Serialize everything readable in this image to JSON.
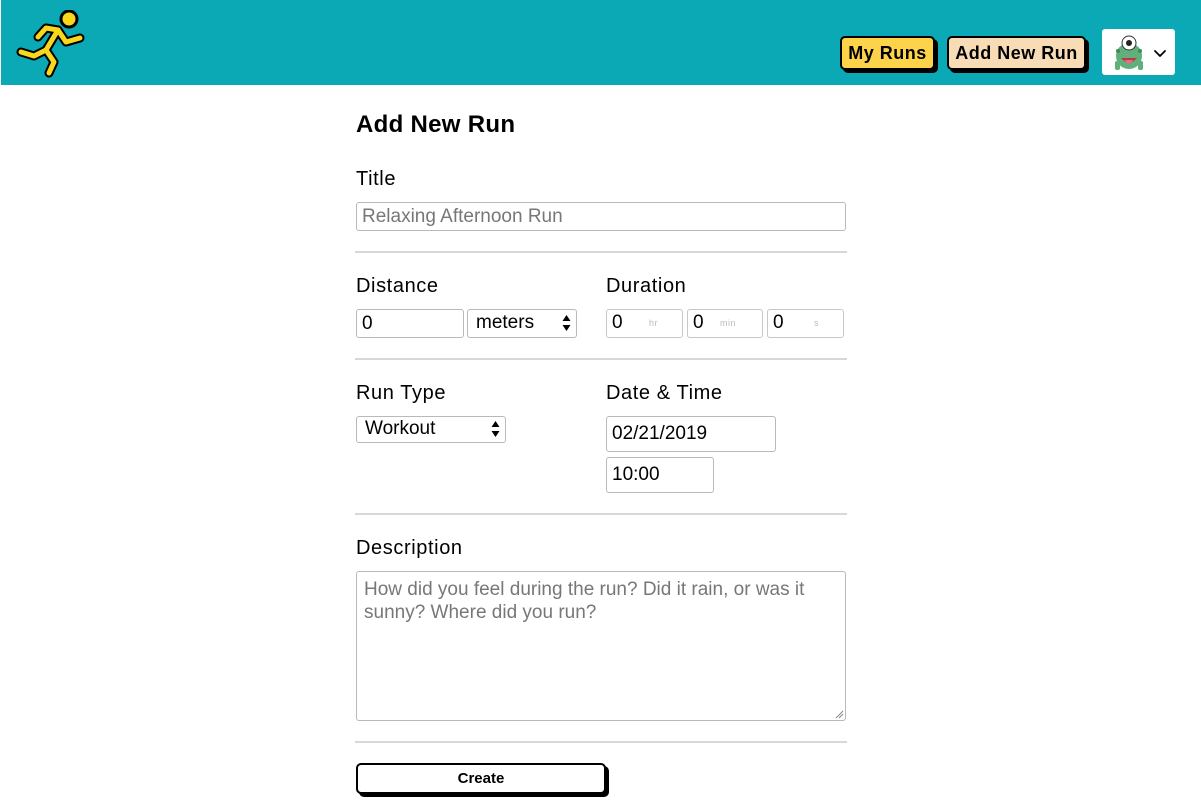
{
  "header": {
    "background_color": "#0ba8b6",
    "logo_icon": "running-person-icon",
    "nav": {
      "my_runs_label": "My Runs",
      "my_runs_color": "#fdd34a",
      "add_new_run_label": "Add New Run",
      "add_new_run_color": "#f7dcb6"
    },
    "user_menu": {
      "avatar_icon": "monster-avatar-icon",
      "dropdown_icon": "chevron-down-icon"
    }
  },
  "form": {
    "title": "Add New Run",
    "title_field": {
      "label": "Title",
      "value": "",
      "placeholder": "Relaxing Afternoon Run"
    },
    "distance": {
      "label": "Distance",
      "value": "0",
      "unit_selected": "meters"
    },
    "duration": {
      "label": "Duration",
      "hours": "0",
      "hours_hint": "hr",
      "minutes": "0",
      "minutes_hint": "min",
      "seconds": "0",
      "seconds_hint": "s"
    },
    "run_type": {
      "label": "Run Type",
      "selected": "Workout"
    },
    "date_time": {
      "label": "Date & Time",
      "date": "02/21/2019",
      "time": "10:00"
    },
    "description": {
      "label": "Description",
      "value": "",
      "placeholder": "How did you feel during the run? Did it rain, or was it sunny? Where did you run?"
    },
    "submit_label": "Create"
  }
}
